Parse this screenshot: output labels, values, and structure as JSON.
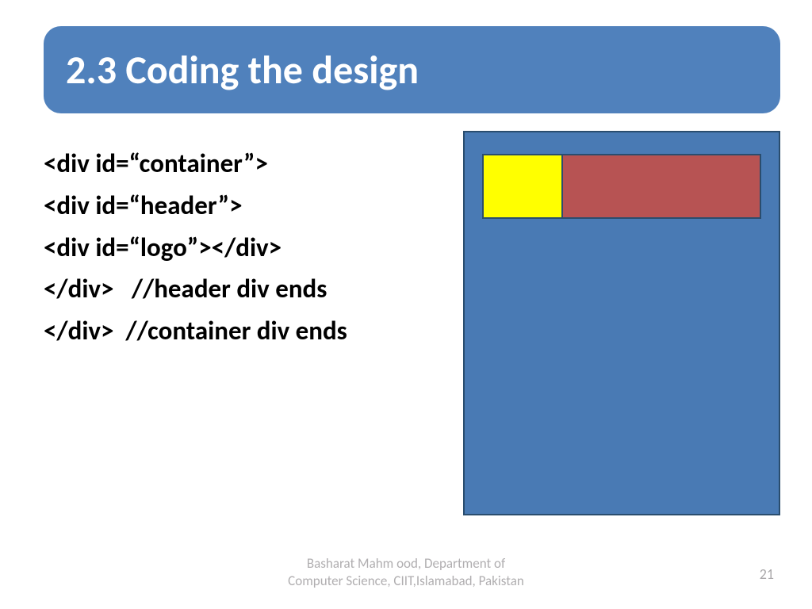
{
  "title": "2.3 Coding the design",
  "code": {
    "line1": "<div id=“container”>",
    "line2": "<div id=“header”>",
    "line3": "<div id=“logo”></div>",
    "line4": "</div>   //header div ends",
    "line5": "</div>  //container div ends"
  },
  "footer": {
    "line1": "Basharat Mahm ood, Department of",
    "line2": "Computer Science, CIIT,Islamabad, Pakistan"
  },
  "page_number": "21"
}
